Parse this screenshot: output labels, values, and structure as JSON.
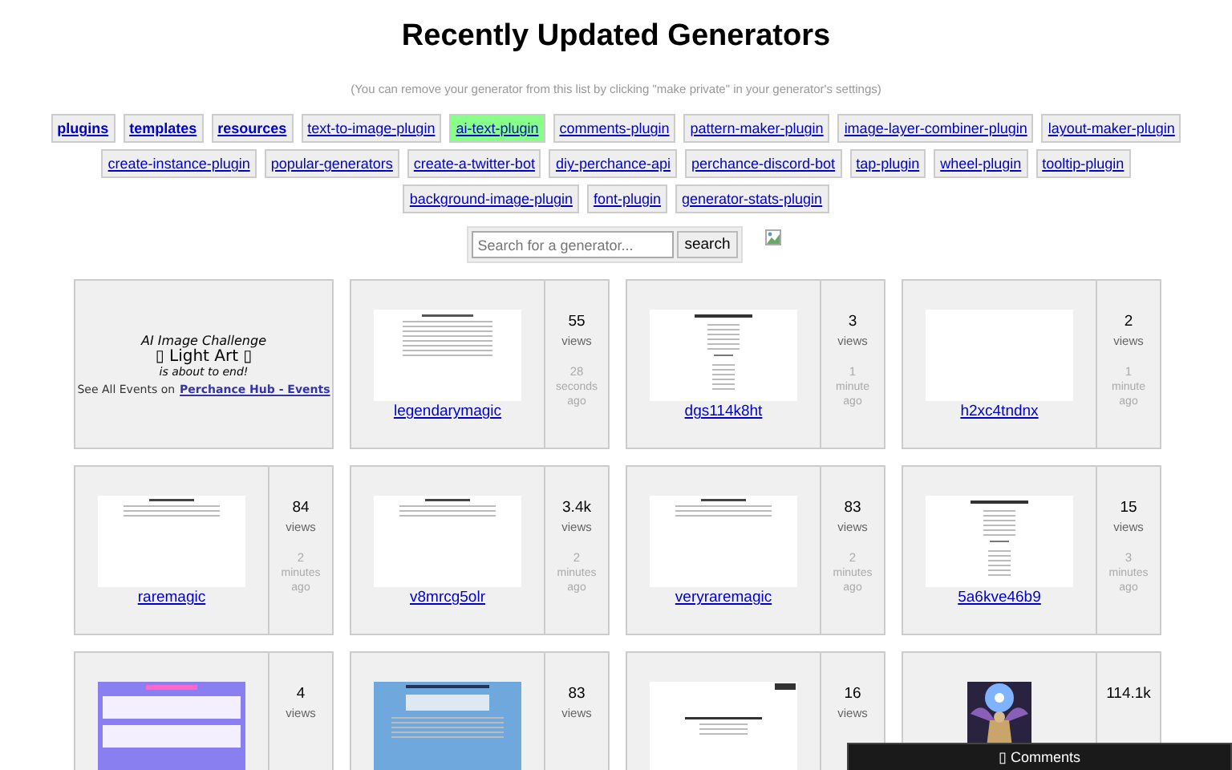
{
  "title": "Recently Updated Generators",
  "subtitle": "(You can remove your generator from this list by clicking \"make private\" in your generator's settings)",
  "tags": [
    {
      "label": "plugins",
      "bold": true,
      "highlighted": false
    },
    {
      "label": "templates",
      "bold": true,
      "highlighted": false
    },
    {
      "label": "resources",
      "bold": true,
      "highlighted": false
    },
    {
      "label": "text-to-image-plugin",
      "bold": false,
      "highlighted": false
    },
    {
      "label": "ai-text-plugin",
      "bold": false,
      "highlighted": true
    },
    {
      "label": "comments-plugin",
      "bold": false,
      "highlighted": false
    },
    {
      "label": "pattern-maker-plugin",
      "bold": false,
      "highlighted": false
    },
    {
      "label": "image-layer-combiner-plugin",
      "bold": false,
      "highlighted": false
    },
    {
      "label": "layout-maker-plugin",
      "bold": false,
      "highlighted": false
    },
    {
      "label": "create-instance-plugin",
      "bold": false,
      "highlighted": false
    },
    {
      "label": "popular-generators",
      "bold": false,
      "highlighted": false
    },
    {
      "label": "create-a-twitter-bot",
      "bold": false,
      "highlighted": false
    },
    {
      "label": "diy-perchance-api",
      "bold": false,
      "highlighted": false
    },
    {
      "label": "perchance-discord-bot",
      "bold": false,
      "highlighted": false
    },
    {
      "label": "tap-plugin",
      "bold": false,
      "highlighted": false
    },
    {
      "label": "wheel-plugin",
      "bold": false,
      "highlighted": false
    },
    {
      "label": "tooltip-plugin",
      "bold": false,
      "highlighted": false
    },
    {
      "label": "background-image-plugin",
      "bold": false,
      "highlighted": false
    },
    {
      "label": "font-plugin",
      "bold": false,
      "highlighted": false
    },
    {
      "label": "generator-stats-plugin",
      "bold": false,
      "highlighted": false
    }
  ],
  "search": {
    "placeholder": "Search for a generator...",
    "button": "search"
  },
  "event_card": {
    "title": "AI Image Challenge",
    "subtitle": "▯ Light Art ▯",
    "note": "is about to end!",
    "prefix": "See All Events on",
    "link": "Perchance Hub - Events"
  },
  "generators": [
    {
      "name": "legendarymagic",
      "views": "55",
      "views_label": "views",
      "time": [
        "28",
        "seconds",
        "ago"
      ],
      "kind": "text-page"
    },
    {
      "name": "dgs114k8ht",
      "views": "3",
      "views_label": "views",
      "time": [
        "1",
        "minute",
        "ago"
      ],
      "kind": "list-page"
    },
    {
      "name": "h2xc4tndnx",
      "views": "2",
      "views_label": "views",
      "time": [
        "1",
        "minute",
        "ago"
      ],
      "kind": "blank"
    },
    {
      "name": "raremagic",
      "views": "84",
      "views_label": "views",
      "time": [
        "2",
        "minutes",
        "ago"
      ],
      "kind": "short-page"
    },
    {
      "name": "v8mrcg5olr",
      "views": "3.4k",
      "views_label": "views",
      "time": [
        "2",
        "minutes",
        "ago"
      ],
      "kind": "short-page"
    },
    {
      "name": "veryraremagic",
      "views": "83",
      "views_label": "views",
      "time": [
        "2",
        "minutes",
        "ago"
      ],
      "kind": "short-page"
    },
    {
      "name": "5a6kve46b9",
      "views": "15",
      "views_label": "views",
      "time": [
        "3",
        "minutes",
        "ago"
      ],
      "kind": "list-page"
    },
    {
      "views": "4",
      "views_label": "views",
      "kind": "purple-form"
    },
    {
      "views": "83",
      "views_label": "views",
      "kind": "blue-form"
    },
    {
      "views": "16",
      "views_label": "views",
      "kind": "dark-header"
    },
    {
      "views": "114.1k",
      "kind": "picture"
    }
  ],
  "comments_button": "▯ Comments"
}
